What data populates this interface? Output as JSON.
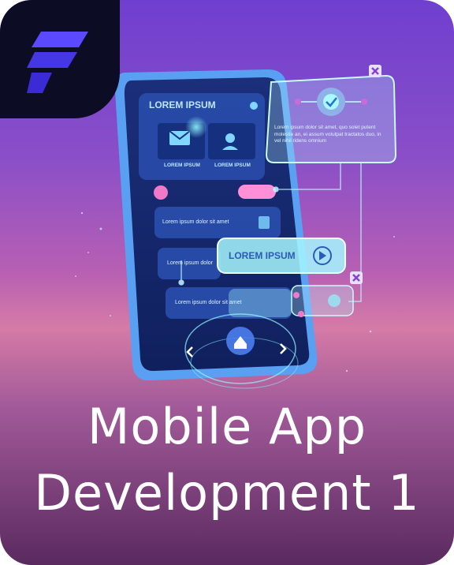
{
  "logo": {
    "icon": "brand-f-logo-icon",
    "colors": [
      "#5a49ff",
      "#3b2bd6"
    ]
  },
  "illustration": {
    "phone_header": "LOREM IPSUM",
    "tile_left_label": "LOREM IPSUM",
    "tile_right_label": "LOREM IPSUM",
    "row_1": "Lorem ipsum dolor sit amet",
    "row_2": "Lorem ipsum dolor",
    "row_3": "Lorem ipsum dolor sit amet",
    "popup_label": "LOREM IPSUM",
    "panel_text": "Lorem ipsum dolor sit amet, quo solet putent molestie an, ei assum volutpat tractatos duo, in vel nihil ridens omnium"
  },
  "title": {
    "line1": "Mobile App",
    "line2": "Development 1"
  }
}
